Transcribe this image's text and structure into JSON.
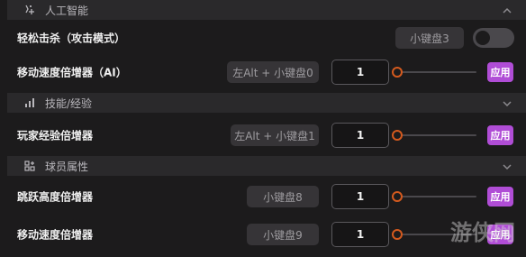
{
  "sections": [
    {
      "label": "人工智能",
      "icon": "ai-sparkle-icon",
      "rows": [
        {
          "label": "轻松击杀（攻击模式）",
          "hotkey": "小键盘3",
          "control": "toggle",
          "toggle_on": false
        },
        {
          "label": "移动速度倍增器（AI）",
          "hotkey": "左Alt + 小键盘0",
          "control": "slider",
          "value": "1",
          "apply_label": "应用"
        }
      ]
    },
    {
      "label": "技能/经验",
      "icon": "bar-chart-icon",
      "rows": [
        {
          "label": "玩家经验倍增器",
          "hotkey": "左Alt + 小键盘1",
          "control": "slider",
          "value": "1",
          "apply_label": "应用"
        }
      ]
    },
    {
      "label": "球员属性",
      "icon": "attributes-icon",
      "rows": [
        {
          "label": "跳跃高度倍增器",
          "hotkey": "小键盘8",
          "control": "slider",
          "value": "1",
          "apply_label": "应用"
        },
        {
          "label": "移动速度倍增器",
          "hotkey": "小键盘9",
          "control": "slider",
          "value": "1",
          "apply_label": "应用"
        }
      ]
    }
  ],
  "watermark": {
    "text": "游侠网"
  },
  "colors": {
    "accent": "#b04dd6",
    "slider_thumb": "#d45a1e",
    "background": "#1c1b1c",
    "section_bg": "#2a292b"
  }
}
